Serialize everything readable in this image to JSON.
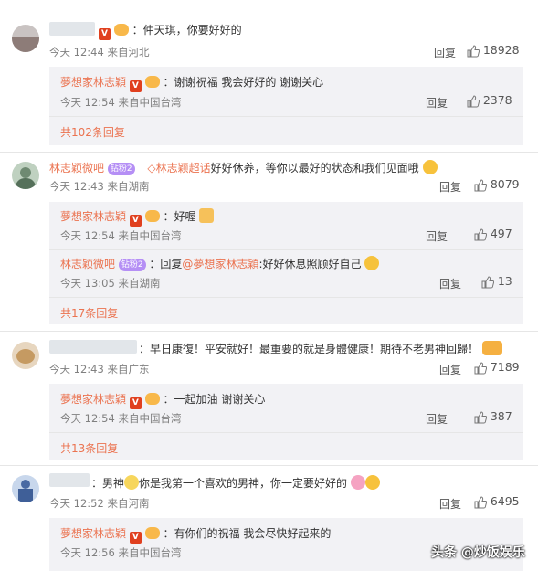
{
  "comments": [
    {
      "user": "",
      "text": "：仲天琪，你要好好的",
      "time": "今天 12:44 来自河北",
      "reply_label": "回复",
      "likes": "18928",
      "replies": [
        {
          "user": "夢想家林志穎",
          "text": "：谢谢祝福 我会好好的 谢谢关心",
          "time": "今天 12:54 来自中国台湾",
          "reply_label": "回复",
          "likes": "2378"
        }
      ],
      "more": "共102条回复"
    },
    {
      "user": "林志颖微吧",
      "fan_badge": "钻粉2",
      "text_prefix": "林志颖超话",
      "text": "好好休养，等你以最好的状态和我们见面哦",
      "time": "今天 12:43 来自湖南",
      "reply_label": "回复",
      "likes": "8079",
      "replies": [
        {
          "user": "夢想家林志穎",
          "text": "：好喔",
          "time": "今天 12:54 来自中国台湾",
          "reply_label": "回复",
          "likes": "497"
        },
        {
          "user": "林志颖微吧",
          "fan_badge": "钻粉2",
          "text_pre": "：回复",
          "mention": "@夢想家林志穎",
          "text": ":好好休息照顾好自己",
          "time": "今天 13:05 来自湖南",
          "reply_label": "回复",
          "likes": "13"
        }
      ],
      "more": "共17条回复"
    },
    {
      "user": "",
      "text": "：早日康復！平安就好！最重要的就是身體健康！期待不老男神回歸！",
      "time": "今天 12:43 来自广东",
      "reply_label": "回复",
      "likes": "7189",
      "replies": [
        {
          "user": "夢想家林志穎",
          "text": "：一起加油 谢谢关心",
          "time": "今天 12:54 来自中国台湾",
          "reply_label": "回复",
          "likes": "387"
        }
      ],
      "more": "共13条回复"
    },
    {
      "user": "",
      "text_pre": "：男神",
      "text": "你是我第一个喜欢的男神，你一定要好好的",
      "time": "今天 12:52 来自河南",
      "reply_label": "回复",
      "likes": "6495",
      "replies": [
        {
          "user": "夢想家林志穎",
          "text": "：有你们的祝福 我会尽快好起来的",
          "time": "今天 12:56 来自中国台湾",
          "reply_label": "回复",
          "likes": ""
        }
      ]
    }
  ],
  "watermark": "头条 @炒饭娱乐",
  "colors": {
    "name": "#eb7350",
    "sub_bg": "#f2f2f5",
    "meta": "#808080"
  }
}
